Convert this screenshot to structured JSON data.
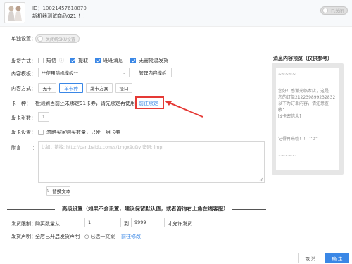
{
  "header": {
    "id_text": "ID：10021457618870",
    "product_name": "新机器测试商品021 ！！",
    "close_toggle_label": "已关闭"
  },
  "single_setting": {
    "label": "单独设置：",
    "toggle_label": "关闭统SKU设置"
  },
  "delivery_method": {
    "label": "发货方式：",
    "options": [
      {
        "label": "短信",
        "checked": false
      },
      {
        "label": "提取",
        "checked": true
      },
      {
        "label": "旺旺消息",
        "checked": true
      },
      {
        "label": "无需物流发货",
        "checked": true
      }
    ]
  },
  "content_template": {
    "label": "内容模板：",
    "value": "**使用随机模板**",
    "manage_button": "管理内容模板"
  },
  "content_method": {
    "label": "内容方式：",
    "options": [
      "无卡",
      "单卡种",
      "发卡方案",
      "接口"
    ],
    "active_index": 1
  },
  "card_type": {
    "label": "卡　种：",
    "message": "检测到当前还未绑定91卡券，请先绑定再使用",
    "bind_link": "前往绑定"
  },
  "card_count": {
    "label": "发卡张数：",
    "value": "1"
  },
  "card_setting": {
    "label": "发卡设置：",
    "text": "忽略买家购买数量，只发一组卡券"
  },
  "attachment": {
    "label": "附言",
    "colon": "：",
    "placeholder": "比如：链接: http://pan.baidu.com/s/1mgx9uDy 密码: lmpr"
  },
  "replace_text_button": "替换文本",
  "advanced": {
    "title": "高级设置（如果不会设置，建议保留默认值，或者咨询右上角在线客服）"
  },
  "delivery_limit": {
    "label": "发货限制：",
    "prefix": "购买数量从",
    "from": "1",
    "to_label": "到",
    "to": "9999",
    "suffix": "才允许发货"
  },
  "delivery_statement": {
    "label": "发货声明：",
    "text": "全店已开启发货声明",
    "status": "已选一文案",
    "link": "前往修改"
  },
  "preview": {
    "title": "消息内容预览（仅供参考）",
    "lines": [
      "~~~~~",
      "您好！感谢光临本店，这是",
      "您的订单212239899232832",
      "以下为订单内容，请注意查",
      "收：",
      "[$卡密信息]",
      "记得再来哦！！ ^0^",
      "~~~~~"
    ]
  },
  "footer": {
    "cancel": "取 消",
    "confirm": "确 定"
  },
  "colors": {
    "accent": "#3a87e6",
    "highlight": "#e53935"
  }
}
